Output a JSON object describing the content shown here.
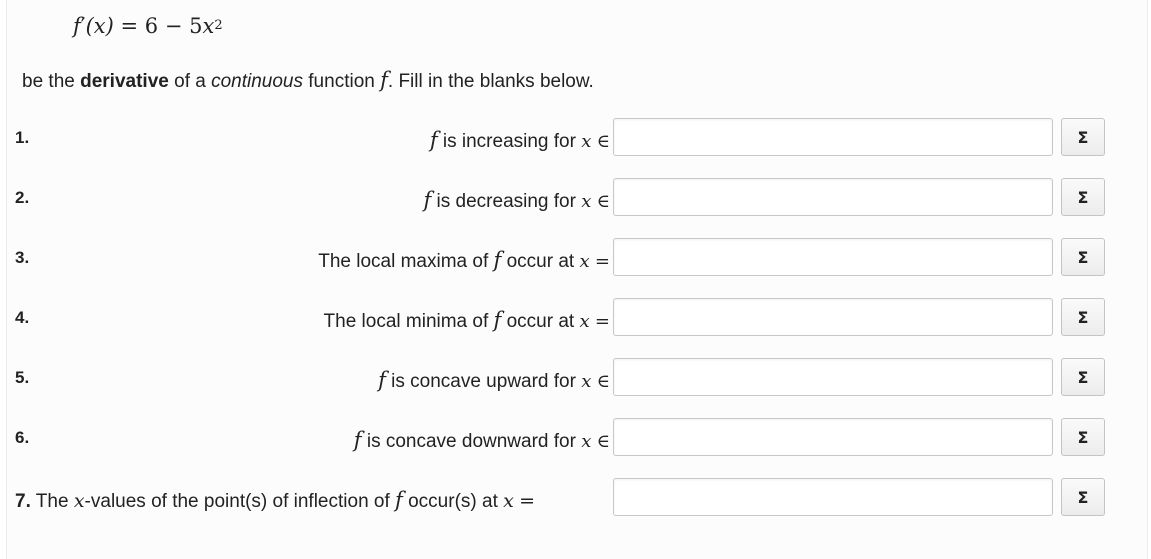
{
  "formula": {
    "lhs_fn": "f",
    "lhs_prime": "′",
    "lhs_arg": "(x)",
    "eq": "=",
    "rhs_const": "6",
    "minus": "−",
    "rhs_coef": "5",
    "rhs_var": "x",
    "rhs_exp": "2"
  },
  "intro": {
    "part1": "be the ",
    "bold": "derivative",
    "part2": " of a ",
    "italic": "continuous",
    "part3": " function ",
    "fn": "f",
    "part4": ".  Fill in the blanks below."
  },
  "questions": [
    {
      "num": "1.",
      "fn": "f",
      "text": " is increasing for ",
      "var": "x",
      "rel": "∈",
      "value": ""
    },
    {
      "num": "2.",
      "fn": "f",
      "text": " is decreasing for ",
      "var": "x",
      "rel": "∈",
      "value": ""
    },
    {
      "num": "3.",
      "pre": "The local maxima of ",
      "fn": "f",
      "text": " occur at ",
      "var": "x",
      "rel": "=",
      "value": ""
    },
    {
      "num": "4.",
      "pre": "The local minima of ",
      "fn": "f",
      "text": " occur at ",
      "var": "x",
      "rel": "=",
      "value": ""
    },
    {
      "num": "5.",
      "fn": "f",
      "text": " is concave upward for ",
      "var": "x",
      "rel": "∈",
      "value": ""
    },
    {
      "num": "6.",
      "fn": "f",
      "text": " is concave downward for ",
      "var": "x",
      "rel": "∈",
      "value": ""
    }
  ],
  "question7": {
    "num": "7.",
    "pre": " The ",
    "var1": "x",
    "mid": "-values of the point(s) of inflection of ",
    "fn": "f",
    "text": " occur(s) at ",
    "var2": "x",
    "rel": "=",
    "value": ""
  },
  "sigma_button_label": "Σ",
  "icons": {
    "sigma": "sigma-icon"
  }
}
